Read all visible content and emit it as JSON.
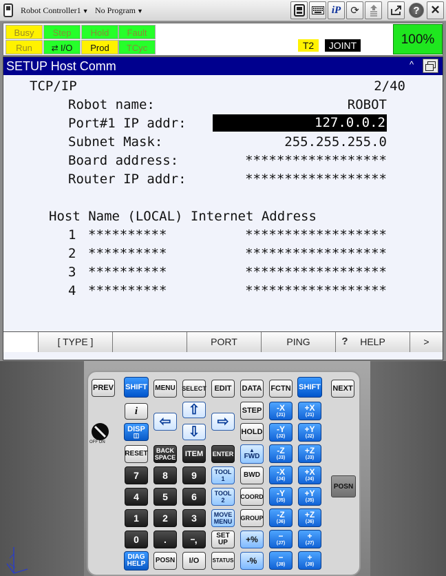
{
  "toolbar": {
    "controller": "Robot Controller1",
    "program": "No Program",
    "icons": [
      "pendant-icon",
      "keyboard-icon",
      "ip-icon",
      "refresh-icon",
      "maintenance-icon",
      "export-icon",
      "help-icon",
      "close-icon"
    ],
    "ip_label": "iP",
    "help_label": "?",
    "close_label": "✕"
  },
  "status": {
    "busy": "Busy",
    "step": "Step",
    "hold": "Hold",
    "fault": "Fault",
    "run": "Run",
    "io": "I/O",
    "prod": "Prod",
    "tcyc": "TCyc",
    "t2": "T2",
    "joint": "JOINT",
    "override": "100%"
  },
  "screen": {
    "title": "SETUP Host Comm",
    "section": "TCP/IP",
    "page": "2/40",
    "rows": [
      {
        "label": "Robot name:",
        "value": "ROBOT"
      },
      {
        "label": "Port#1 IP addr:",
        "value": "127.0.0.2"
      },
      {
        "label": "Subnet Mask:",
        "value": "255.255.255.0"
      },
      {
        "label": "Board address:",
        "value": "******************"
      },
      {
        "label": "Router IP addr:",
        "value": "******************"
      }
    ],
    "host_header": "Host Name (LOCAL) Internet Address",
    "hosts": [
      {
        "num": "1",
        "name": "**********",
        "addr": "******************"
      },
      {
        "num": "2",
        "name": "**********",
        "addr": "******************"
      },
      {
        "num": "3",
        "name": "**********",
        "addr": "******************"
      },
      {
        "num": "4",
        "name": "**********",
        "addr": "******************"
      }
    ]
  },
  "fkeys": {
    "f1": "[ TYPE ]",
    "f3": "PORT",
    "f4": "PING",
    "f5": "HELP",
    "next": ">"
  },
  "keys": {
    "prev": "PREV",
    "shift": "SHIFT",
    "menu": "MENU",
    "select": "SELECT",
    "edit": "EDIT",
    "data": "DATA",
    "fctn": "FCTN",
    "next": "NEXT",
    "info": "i",
    "disp": "DISP",
    "reset": "RESET",
    "backspace_1": "BACK",
    "backspace_2": "SPACE",
    "item": "ITEM",
    "enter": "ENTER",
    "step": "STEP",
    "hold": "HOLD",
    "fwd": "FWD",
    "bwd": "BWD",
    "coord": "COORD",
    "group": "GROUP",
    "tool1_1": "TOOL",
    "tool1_2": "1",
    "tool2_1": "TOOL",
    "tool2_2": "2",
    "movemenu_1": "MOVE",
    "movemenu_2": "MENU",
    "setup_1": "SET",
    "setup_2": "UP",
    "diag_1": "DIAG",
    "diag_2": "HELP",
    "posn": "POSN",
    "io": "I/O",
    "status": "STATUS",
    "n7": "7",
    "n8": "8",
    "n9": "9",
    "n4": "4",
    "n5": "5",
    "n6": "6",
    "n1": "1",
    "n2": "2",
    "n3": "3",
    "n0": "0",
    "dot": ".",
    "comma": ",",
    "plus_pct": "+%",
    "minus_pct": "-%",
    "jog_minus": [
      "-X",
      "-Y",
      "-Z",
      "-X",
      "-Y",
      "-Z",
      "−",
      "−"
    ],
    "jog_minus_sub": [
      "(J1)",
      "(J2)",
      "(J3)",
      "(J4)",
      "(J5)",
      "(J6)",
      "(J7)",
      "(J8)"
    ],
    "jog_plus": [
      "+X",
      "+Y",
      "+Z",
      "+X",
      "+Y",
      "+Z",
      "+",
      "+"
    ],
    "jog_plus_sub": [
      "(J1)",
      "(J2)",
      "(J3)",
      "(J4)",
      "(J5)",
      "(J6)",
      "(J7)",
      "(J8)"
    ],
    "posn_side": "POSN",
    "enable_label": "OFF  ON"
  }
}
